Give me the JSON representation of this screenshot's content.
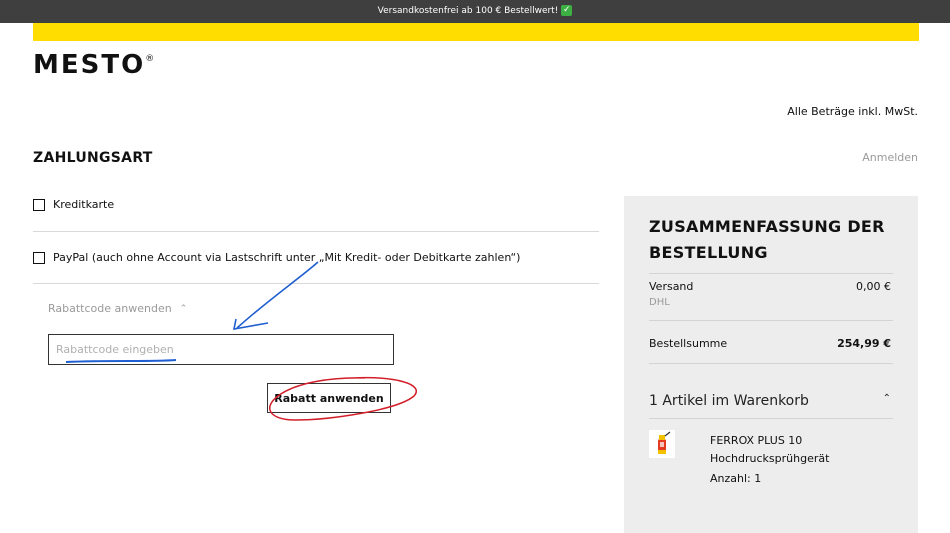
{
  "topbar": {
    "text": "Versandkostenfrei ab 100 € Bestellwert!",
    "check_icon": "check-mark-icon"
  },
  "brand": {
    "logo_text": "MESTO",
    "registered": "®"
  },
  "header": {
    "vat_note": "Alle Beträge inkl. MwSt."
  },
  "payment": {
    "title": "ZAHLUNGSART",
    "login_link": "Anmelden",
    "options": [
      {
        "label": "Kreditkarte",
        "checked": false
      },
      {
        "label": "PayPal (auch ohne Account via Lastschrift unter „Mit Kredit- oder Debitkarte zahlen“)",
        "checked": false
      }
    ]
  },
  "coupon": {
    "toggle_label": "Rabattcode anwenden",
    "input_placeholder": "Rabattcode eingeben",
    "input_value": "",
    "apply_label": "Rabatt anwenden"
  },
  "summary": {
    "title": "ZUSAMMENFASSUNG DER BESTELLUNG",
    "shipping_label": "Versand",
    "shipping_value": "0,00 €",
    "shipping_carrier": "DHL",
    "total_label": "Bestellsumme",
    "total_value": "254,99 €",
    "cart_toggle": "1 Artikel im Warenkorb",
    "item": {
      "name": "FERROX PLUS 10 Hochdrucksprühgerät",
      "qty": "Anzahl: 1"
    }
  },
  "colors": {
    "accent_yellow": "#ffdd00",
    "topbar_bg": "#3f3f3f",
    "summary_bg": "#ededed",
    "annotation_blue": "#1f5fd1",
    "annotation_red": "#d21f2a"
  }
}
